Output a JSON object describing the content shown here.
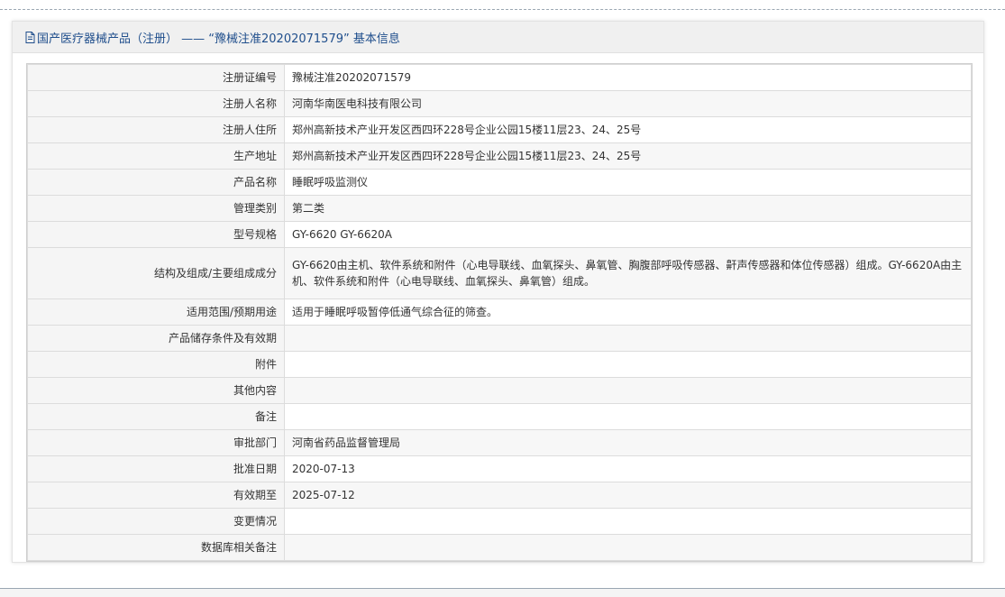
{
  "panel": {
    "title": "国产医疗器械产品（注册） —— “豫械注准20202071579” 基本信息"
  },
  "rows": [
    {
      "label": "注册证编号",
      "value": "豫械注准20202071579"
    },
    {
      "label": "注册人名称",
      "value": "河南华南医电科技有限公司"
    },
    {
      "label": "注册人住所",
      "value": "郑州高新技术产业开发区西四环228号企业公园15楼11层23、24、25号"
    },
    {
      "label": "生产地址",
      "value": "郑州高新技术产业开发区西四环228号企业公园15楼11层23、24、25号"
    },
    {
      "label": "产品名称",
      "value": "睡眠呼吸监测仪"
    },
    {
      "label": "管理类别",
      "value": "第二类"
    },
    {
      "label": "型号规格",
      "value": "GY-6620 GY-6620A"
    },
    {
      "label": "结构及组成/主要组成成分",
      "value": "GY-6620由主机、软件系统和附件（心电导联线、血氧探头、鼻氧管、胸腹部呼吸传感器、鼾声传感器和体位传感器）组成。GY-6620A由主机、软件系统和附件（心电导联线、血氧探头、鼻氧管）组成。"
    },
    {
      "label": "适用范围/预期用途",
      "value": "适用于睡眠呼吸暂停低通气综合征的筛查。"
    },
    {
      "label": "产品储存条件及有效期",
      "value": ""
    },
    {
      "label": "附件",
      "value": ""
    },
    {
      "label": "其他内容",
      "value": ""
    },
    {
      "label": "备注",
      "value": ""
    },
    {
      "label": "审批部门",
      "value": "河南省药品监督管理局"
    },
    {
      "label": "批准日期",
      "value": "2020-07-13"
    },
    {
      "label": "有效期至",
      "value": "2025-07-12"
    },
    {
      "label": "变更情况",
      "value": ""
    },
    {
      "label": "数据库相关备注",
      "value": ""
    }
  ]
}
